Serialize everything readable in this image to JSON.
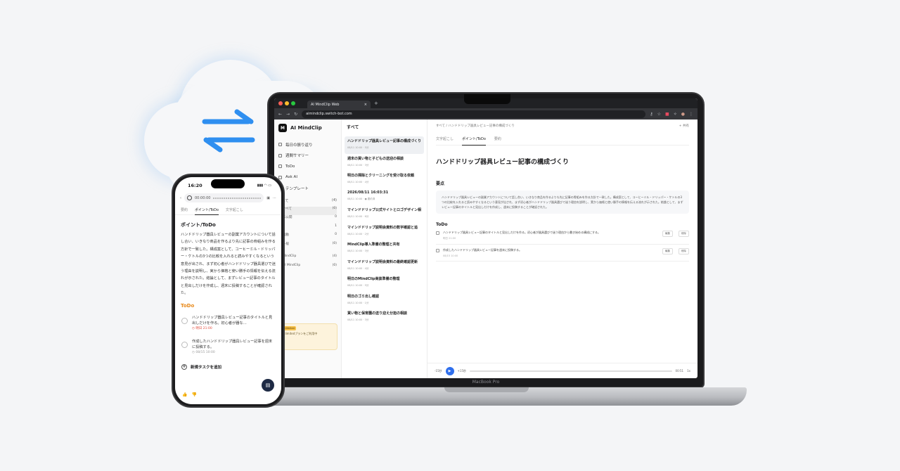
{
  "colors": {
    "background": "#f4f5f7",
    "sync_blue": "#2f8ff0",
    "todo_orange": "#e8891a",
    "play_blue": "#2f6fed"
  },
  "browser": {
    "tab_title": "AI MindClip Web",
    "url": "aimindclip.switch-bot.com"
  },
  "app": {
    "brand": "AI MindClip",
    "brand_logo": "M",
    "nav": [
      "毎日の振り返り",
      "週間サマリー",
      "ToDo",
      "Ask AI",
      "テンプレート"
    ],
    "section_head": {
      "label": "すべて",
      "count": "(4)"
    },
    "sidebar_rows": [
      {
        "label": "すべて",
        "count": "(0)"
      },
      {
        "label": "未公開",
        "count": "0"
      },
      {
        "label": "",
        "count": "1"
      },
      {
        "label": "自動",
        "count": "0"
      },
      {
        "label": "一般",
        "count": "(0)"
      },
      {
        "label": "MindClip",
        "count": "(4)"
      },
      {
        "label": "AI MindClip",
        "count": "(0)"
      }
    ],
    "promo": {
      "badge": "Unlimited",
      "text": "Unlimitedプランをご利用中"
    },
    "list_header": "すべて",
    "list_items": [
      {
        "title": "ハンドドリップ器具レビュー記事の構成づくり",
        "date": "08/11 10:00 · 5分"
      },
      {
        "title": "週末の買い物と子どもの送迎の相談",
        "date": "08/11 10:00 · 3分"
      },
      {
        "title": "明日の掃除とクリーニングを受け取る依頼",
        "date": "08/11 10:00 · 4分"
      },
      {
        "title": "2026/08/11 16:03:31",
        "date": "08/11 10:00 · ● 要約済"
      },
      {
        "title": "マインドドリップ公式サイトとロゴデザイン相談",
        "date": "08/11 10:00 · 6分"
      },
      {
        "title": "マインドドリップ説明会資料の数字確認と追",
        "date": "08/11 10:00 · 2分"
      },
      {
        "title": "MindClip導入準備の整理と共有",
        "date": "08/11 10:00 · 3分"
      },
      {
        "title": "マインドドリップ説明会資料の最終確認更新",
        "date": "08/11 10:00 · 4分"
      },
      {
        "title": "明日のMindClip商談準備の整理",
        "date": "08/11 10:00 · 5分"
      },
      {
        "title": "明日のゴミ出し確認",
        "date": "08/11 10:00 · 1分"
      },
      {
        "title": "買い物と保育園の送り迎え分担の相談",
        "date": "08/11 10:00 · 3分"
      }
    ],
    "detail": {
      "breadcrumb": "すべて / ハンドドリップ器具レビュー記事の構成づくり",
      "share": "+ 共有",
      "tabs": [
        "文字起こし",
        "ポイント/ToDo",
        "要約"
      ],
      "title": "ハンドドリップ器具レビュー記事の構成づくり",
      "summary_label": "要点",
      "summary": "ハンドドリップ器具レビューの副業アカウントについて話し合い、いきなり商品を作るよりも先に記事の骨組みを作る方針で一致した。構成案として、コーヒーミル・ドリッパー・ケトルの3つの比較を入れると読みやすくなるという意見が出され、まず初心者がハンドドリップ器具選びで迷う理由を説明し、実から価格と使い勝手の情報を伝える流れが示された。結論として、まずレビュー記事のタイトルと見出しだけを作成し、週末に投稿することが確認された。",
      "todo_label": "ToDo",
      "todos": [
        {
          "text": "ハンドドリップ器具レビュー記事のタイトルと見出しだけを作る。初心者が器具選びで迷う理由から書き始める構成にする。",
          "sub": "明日 21:00",
          "btn1": "編集",
          "btn2": "削除"
        },
        {
          "text": "作成したハンドドリップ器具レビュー記事を週末に投稿する。",
          "sub": "08/15 10:00",
          "btn1": "編集",
          "btn2": "削除"
        }
      ],
      "player": {
        "rewind": "-15秒",
        "forward": "+15秒",
        "time": "00:51",
        "speed": "1x"
      }
    }
  },
  "laptop_label": "MacBook Pro",
  "phone": {
    "time": "16:20",
    "player_time": "00:00:00",
    "tabs": [
      "要約",
      "ポイント/ToDo",
      "文字起こし"
    ],
    "heading": "ポイント/ToDo",
    "body": "ハンドドリップ器具レビューの副業アカウントについて話し合い、いきなり商品を作るより先に記事の骨組みを作る方針で一致した。構成案として、コーヒーミル・ドリッパー・ケトルの3つの比較を入れると読みやすくなるという意見が出され、まず初心者がハンドドリップ器具選びで迷う理由を説明し、実から価格と使い勝手の情報を伝える流れが示された。結論として、まずレビュー記事のタイトルと見出しだけを作成し、週末に投稿することが確認された。",
    "todo_heading": "ToDo",
    "todos": [
      {
        "text": "ハンドドリップ器具レビュー記事のタイトルと見出しだけを作る。初心者が器な…",
        "due": "◷ 明日 21:00"
      },
      {
        "text": "作成したハンドドリップ器具レビュー記事を週末に投稿する。",
        "due": "◷ 08/15 10:00"
      }
    ],
    "add_task": "新規タスクを追加"
  }
}
